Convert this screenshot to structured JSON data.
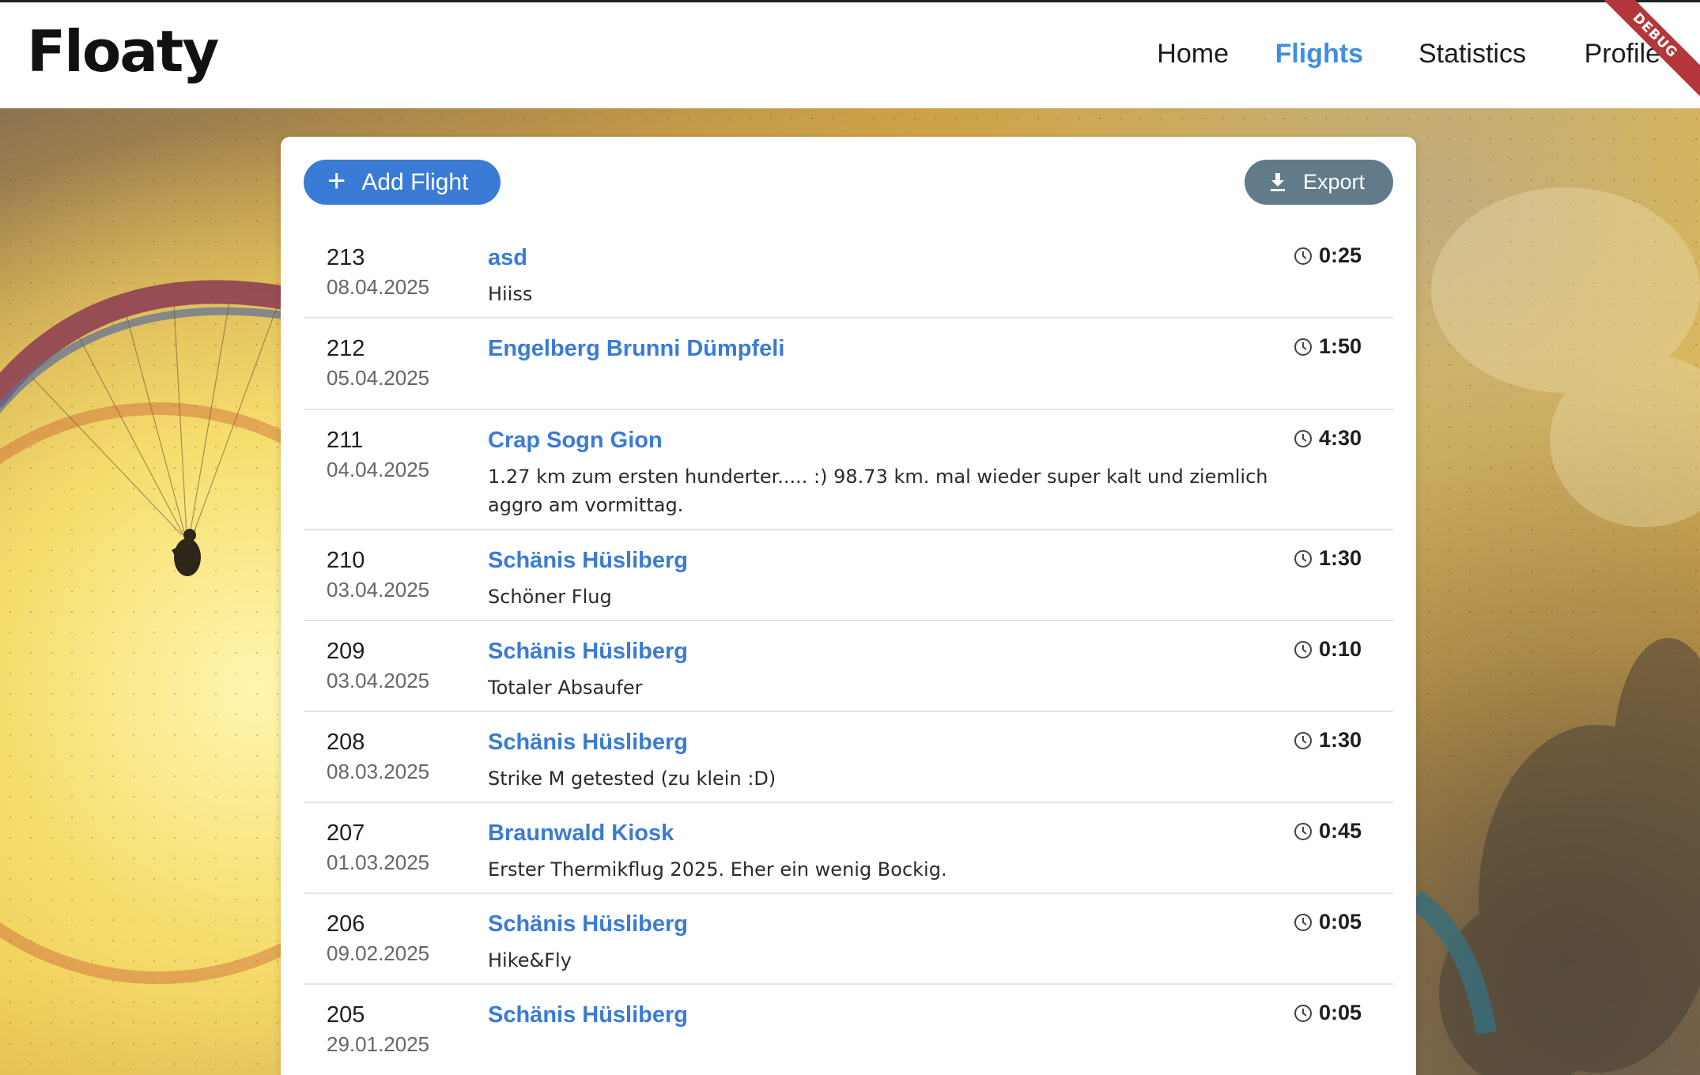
{
  "app": {
    "logo": "Floaty",
    "debug_label": "DEBUG"
  },
  "nav": {
    "items": [
      {
        "label": "Home",
        "active": false
      },
      {
        "label": "Flights",
        "active": true
      },
      {
        "label": "Statistics",
        "active": false
      },
      {
        "label": "Profile",
        "active": false
      }
    ]
  },
  "toolbar": {
    "add_label": "Add Flight",
    "add_icon": "plus-icon",
    "export_label": "Export",
    "export_icon": "download-icon"
  },
  "flights": [
    {
      "number": "213",
      "date": "08.04.2025",
      "location": "asd",
      "description": "Hiiss",
      "duration": "0:25"
    },
    {
      "number": "212",
      "date": "05.04.2025",
      "location": "Engelberg Brunni Dümpfeli",
      "description": "",
      "duration": "1:50"
    },
    {
      "number": "211",
      "date": "04.04.2025",
      "location": "Crap Sogn Gion",
      "description": "1.27 km zum ersten hunderter..... :) 98.73 km. mal wieder super kalt und ziemlich aggro am vormittag.",
      "duration": "4:30"
    },
    {
      "number": "210",
      "date": "03.04.2025",
      "location": "Schänis Hüsliberg",
      "description": "Schöner Flug",
      "duration": "1:30"
    },
    {
      "number": "209",
      "date": "03.04.2025",
      "location": "Schänis Hüsliberg",
      "description": "Totaler Absaufer",
      "duration": "0:10"
    },
    {
      "number": "208",
      "date": "08.03.2025",
      "location": "Schänis Hüsliberg",
      "description": "Strike M getested (zu klein :D)",
      "duration": "1:30"
    },
    {
      "number": "207",
      "date": "01.03.2025",
      "location": "Braunwald Kiosk",
      "description": "Erster Thermikflug 2025. Eher ein wenig Bockig.",
      "duration": "0:45"
    },
    {
      "number": "206",
      "date": "09.02.2025",
      "location": "Schänis Hüsliberg",
      "description": "Hike&Fly",
      "duration": "0:05"
    },
    {
      "number": "205",
      "date": "29.01.2025",
      "location": "Schänis Hüsliberg",
      "description": "",
      "duration": "0:05"
    }
  ],
  "colors": {
    "accent": "#3a7bd5",
    "nav_active": "#3f8fdc",
    "export_button": "#627b8a",
    "debug_banner": "#b3373a"
  }
}
